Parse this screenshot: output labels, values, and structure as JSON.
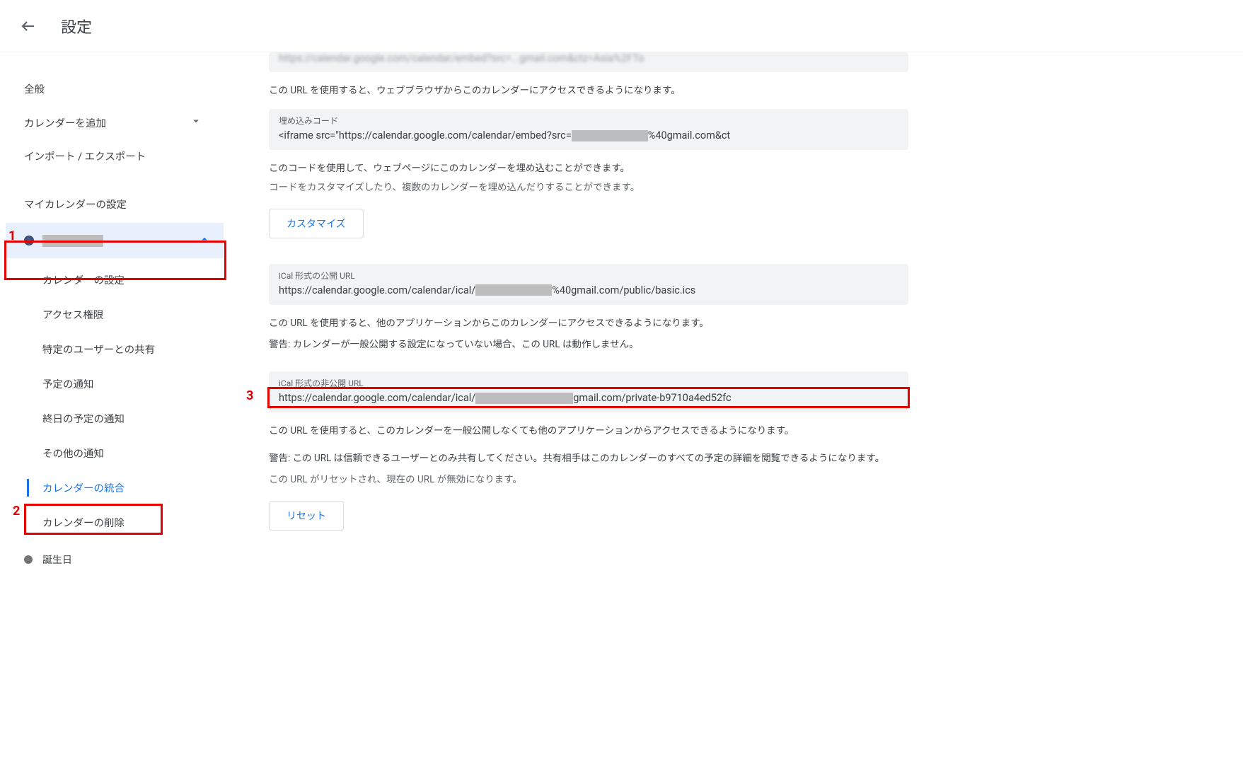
{
  "header": {
    "title": "設定"
  },
  "annotations": {
    "n1": "1",
    "n2": "2",
    "n3": "3"
  },
  "sidebar": {
    "general": "全般",
    "add_calendar": "カレンダーを追加",
    "import_export": "インポート / エクスポート",
    "my_cal_settings": "マイカレンダーの設定",
    "sub": {
      "settings": "カレンダーの設定",
      "access": "アクセス権限",
      "share": "特定のユーザーとの共有",
      "event_notif": "予定の通知",
      "allday_notif": "終日の予定の通知",
      "other_notif": "その他の通知",
      "integrate": "カレンダーの統合",
      "delete": "カレンダーの削除"
    },
    "birthdays": "誕生日"
  },
  "main": {
    "note_public_url": "この URL を使用すると、ウェブブラウザからこのカレンダーにアクセスできるようになります。",
    "embed_label": "埋め込みコード",
    "embed_prefix": "<iframe src=\"https://calendar.google.com/calendar/embed?src=",
    "embed_suffix": "%40gmail.com&ct",
    "embed_note1": "このコードを使用して、ウェブページにこのカレンダーを埋め込むことができます。",
    "embed_note2": "コードをカスタマイズしたり、複数のカレンダーを埋め込んだりすることができます。",
    "customize_btn": "カスタマイズ",
    "ical_public_label": "iCal 形式の公開 URL",
    "ical_public_prefix": "https://calendar.google.com/calendar/ical/",
    "ical_public_suffix": "%40gmail.com/public/basic.ics",
    "ical_public_note1": "この URL を使用すると、他のアプリケーションからこのカレンダーにアクセスできるようになります。",
    "ical_public_note2": "警告: カレンダーが一般公開する設定になっていない場合、この URL は動作しません。",
    "ical_secret_label": "iCal 形式の非公開 URL",
    "ical_secret_prefix": "https://calendar.google.com/calendar/ical/",
    "ical_secret_suffix": "gmail.com/private-b9710a4ed52fc",
    "ical_secret_note1": "この URL を使用すると、このカレンダーを一般公開しなくても他のアプリケーションからアクセスできるようになります。",
    "ical_secret_note2": "警告: この URL は信頼できるユーザーとのみ共有してください。共有相手はこのカレンダーのすべての予定の詳細を閲覧できるようになります。",
    "ical_secret_note3": "この URL がリセットされ、現在の URL が無効になります。",
    "reset_btn": "リセット"
  }
}
